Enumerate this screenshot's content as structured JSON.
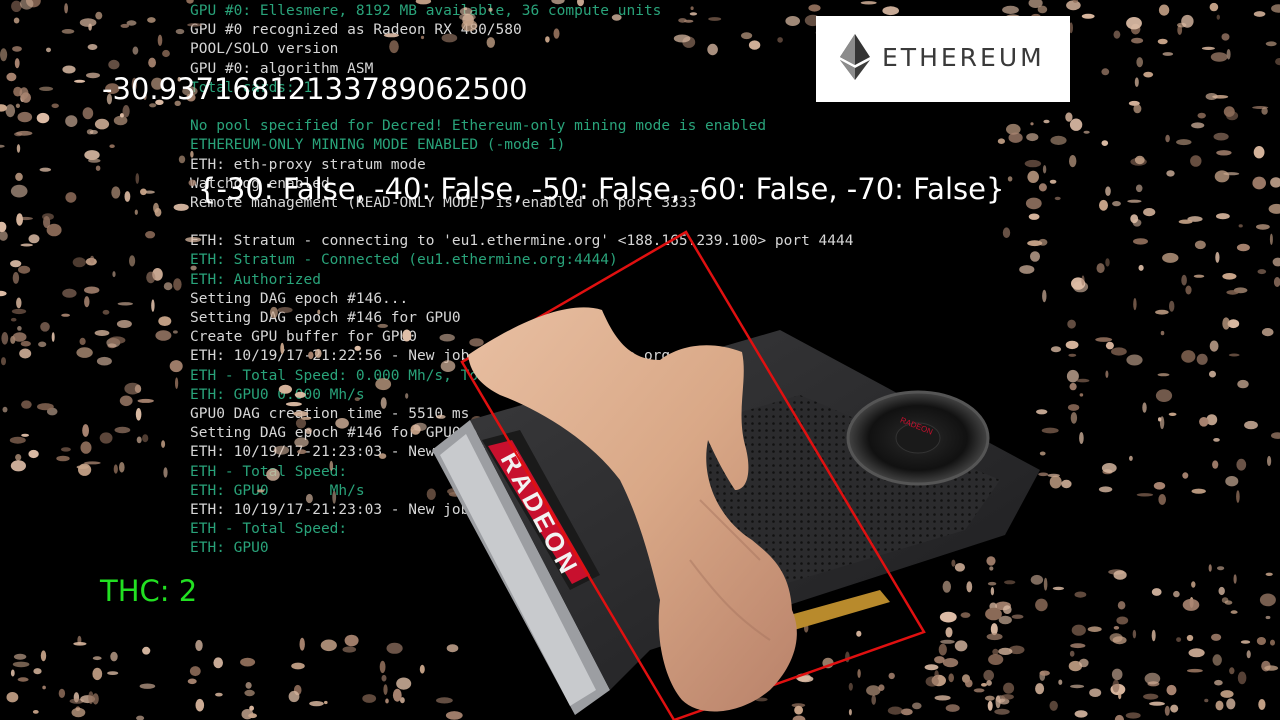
{
  "console_lines": [
    {
      "text": "GPU #0: Ellesmere, 8192 MB available, 36 compute units",
      "color": "green"
    },
    {
      "text": "GPU #0 recognized as Radeon RX 480/580",
      "color": "white"
    },
    {
      "text": "POOL/SOLO version",
      "color": "white"
    },
    {
      "text": "GPU #0: algorithm ASM",
      "color": "white"
    },
    {
      "text": "Total cards: 1",
      "color": "green"
    },
    {
      "text": "",
      "color": "green"
    },
    {
      "text": "No pool specified for Decred! Ethereum-only mining mode is enabled",
      "color": "green"
    },
    {
      "text": "ETHEREUM-ONLY MINING MODE ENABLED (-mode 1)",
      "color": "green"
    },
    {
      "text": "ETH: eth-proxy stratum mode",
      "color": "white"
    },
    {
      "text": "Watchdog enabled",
      "color": "white"
    },
    {
      "text": "Remote management (READ-ONLY MODE) is enabled on port 3333",
      "color": "white"
    },
    {
      "text": "",
      "color": "white"
    },
    {
      "text": "ETH: Stratum - connecting to 'eu1.ethermine.org' <188.165.239.100> port 4444",
      "color": "white"
    },
    {
      "text": "ETH: Stratum - Connected (eu1.ethermine.org:4444)",
      "color": "green"
    },
    {
      "text": "ETH: Authorized",
      "color": "green"
    },
    {
      "text": "Setting DAG epoch #146...",
      "color": "white"
    },
    {
      "text": "Setting DAG epoch #146 for GPU0",
      "color": "white"
    },
    {
      "text": "Create GPU buffer for GPU0",
      "color": "white"
    },
    {
      "text": "ETH: 10/19/17-21:22:56 - New job from eu1.ethermine.org:4444",
      "color": "white"
    },
    {
      "text": "ETH - Total Speed: 0.000 Mh/s, Total Shares: 0, Rejected: 0, Time: 00:00",
      "color": "green"
    },
    {
      "text": "ETH: GPU0 0.000 Mh/s",
      "color": "green"
    },
    {
      "text": "GPU0 DAG creation time - 5510 ms",
      "color": "white"
    },
    {
      "text": "Setting DAG epoch #146 for GPU0 done",
      "color": "white"
    },
    {
      "text": "ETH: 10/19/17-21:23:03 - New job from eu1.ethermine.org:4444",
      "color": "white"
    },
    {
      "text": "ETH - Total Speed:",
      "color": "green"
    },
    {
      "text": "ETH: GPU0       Mh/s",
      "color": "green"
    },
    {
      "text": "ETH: 10/19/17-21:23:03 - New job from eu1.ethermine.org:4444",
      "color": "white"
    },
    {
      "text": "ETH - Total Speed:",
      "color": "green"
    },
    {
      "text": "ETH: GPU0",
      "color": "green"
    }
  ],
  "logo": {
    "word": "ETHEREUM"
  },
  "overlay": {
    "number": "-30.93716812133789062500",
    "dict": "{-30: False, -40: False, -50: False, -60: False, -70: False}",
    "thc": "THC: 2"
  },
  "gpu": {
    "brand": "RADEON"
  },
  "colors": {
    "console_white": "#d6d6d6",
    "console_green": "#29a37a",
    "thc_green": "#22e022",
    "detection_box": "#e01010",
    "radeon_red": "#c8102e",
    "skin": "#d9a887"
  }
}
